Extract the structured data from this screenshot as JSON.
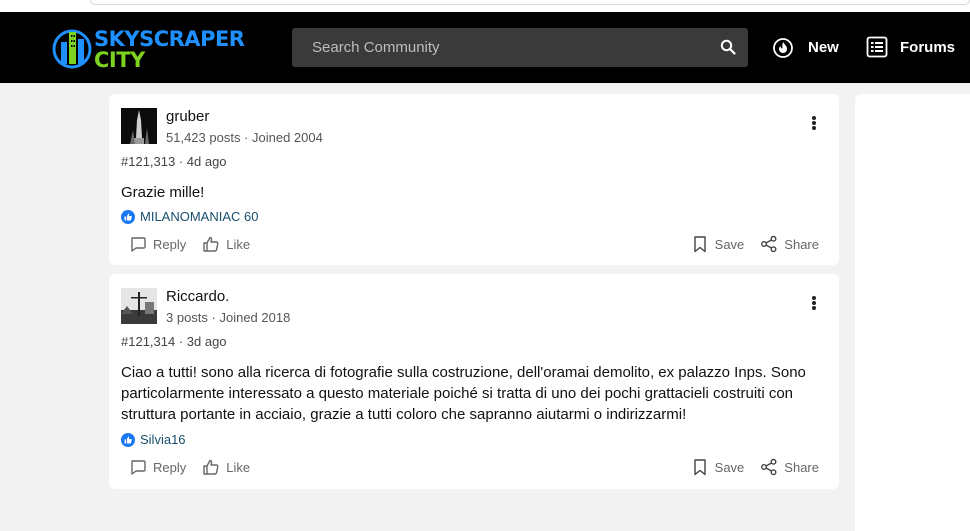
{
  "header": {
    "logo_line1": "SKYSCRAPER",
    "logo_line2": "CITY",
    "search_placeholder": "Search Community",
    "nav_new": "New",
    "nav_forums": "Forums"
  },
  "posts": [
    {
      "username": "gruber",
      "meta": "51,423 posts · Joined 2004",
      "post_number": "#121,313 · 4d ago",
      "body": "Grazie mille!",
      "reaction_text": "MILANOMANIAC 60",
      "reply": "Reply",
      "like": "Like",
      "save": "Save",
      "share": "Share"
    },
    {
      "username": "Riccardo.",
      "meta": "3 posts · Joined 2018",
      "post_number": "#121,314 · 3d ago",
      "body": "Ciao a tutti! sono alla ricerca di fotografie sulla costruzione, dell'oramai demolito, ex palazzo Inps. Sono particolarmente interessato a questo materiale poiché si tratta di uno dei pochi grattacieli costruiti con struttura portante in acciaio, grazie a tutti coloro che sapranno aiutarmi o indirizzarmi!",
      "reaction_text": "Silvia16",
      "reply": "Reply",
      "like": "Like",
      "save": "Save",
      "share": "Share"
    }
  ],
  "colors": {
    "header_bg": "#000000",
    "logo_blue": "#1e90ff",
    "logo_green": "#7ed321",
    "reaction_blue": "#1877f2",
    "page_bg": "#f2f2f2"
  },
  "icons": {
    "search": "search-icon",
    "new": "flame-icon",
    "forums": "list-icon",
    "more": "more-vertical-icon",
    "reply": "comment-icon",
    "like": "thumbs-up-icon",
    "save": "bookmark-icon",
    "share": "share-icon",
    "reaction": "like-reaction-icon"
  }
}
